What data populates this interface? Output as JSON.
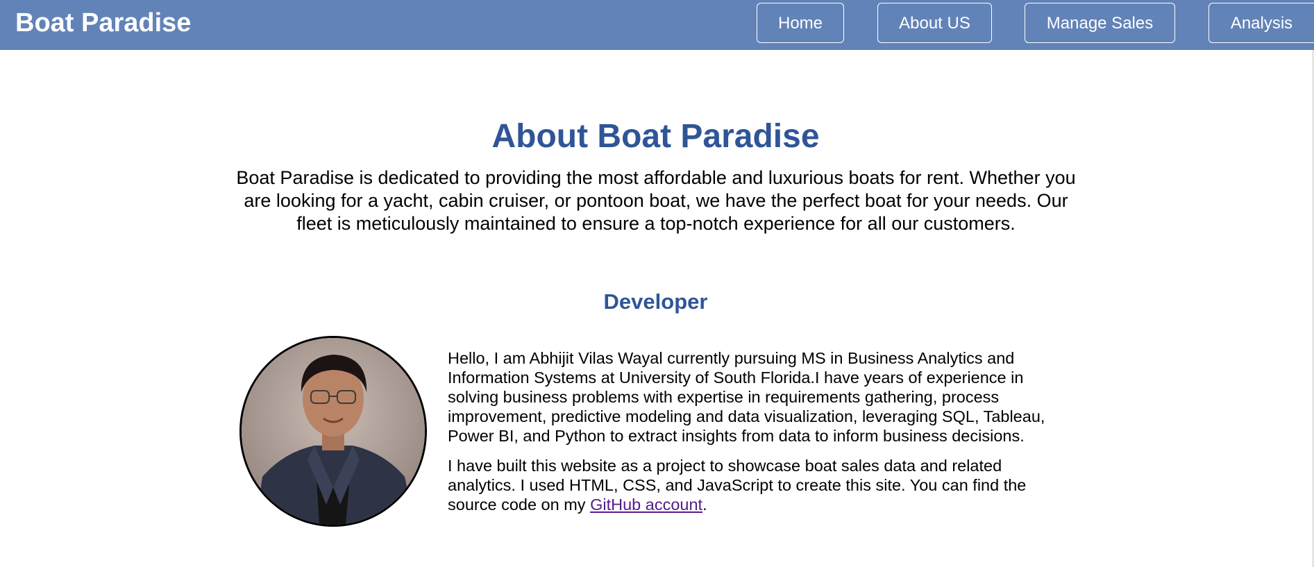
{
  "header": {
    "brand": "Boat Paradise",
    "nav": [
      "Home",
      "About US",
      "Manage Sales",
      "Analysis"
    ]
  },
  "main": {
    "title": "About Boat Paradise",
    "intro": "Boat Paradise is dedicated to providing the most affordable and luxurious boats for rent. Whether you are looking for a yacht, cabin cruiser, or pontoon boat, we have the perfect boat for your needs. Our fleet is meticulously maintained to ensure a top-notch experience for all our customers.",
    "developer_heading": "Developer",
    "bio_p1": "Hello, I am Abhijit Vilas Wayal currently pursuing MS in Business Analytics and Information Systems at University of South Florida.I have years of experience in solving business problems with expertise in requirements gathering, process improvement, predictive modeling and data visualization, leveraging SQL, Tableau, Power BI, and Python to extract insights from data to inform business decisions.",
    "bio_p2_prefix": "I have built this website as a project to showcase boat sales data and related analytics. I used HTML, CSS, and JavaScript to create this site. You can find the source code on my ",
    "bio_p2_link": "GitHub account",
    "bio_p2_suffix": "."
  },
  "colors": {
    "navbar": "#6283b8",
    "heading": "#2f5597",
    "link": "#551a8b"
  }
}
